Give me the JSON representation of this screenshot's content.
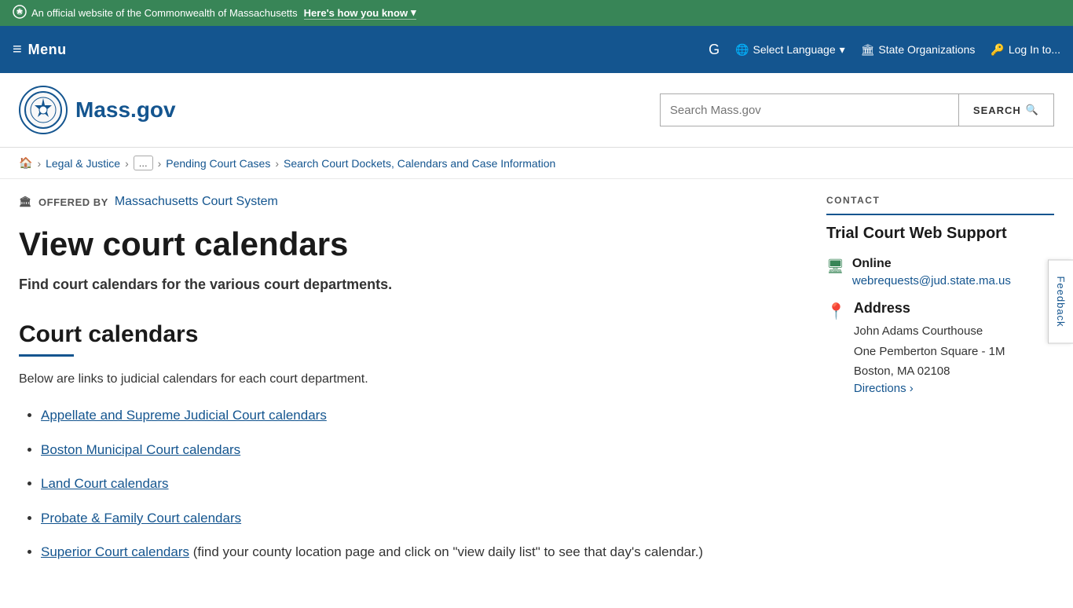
{
  "topBanner": {
    "officialText": "An official website of the Commonwealth of Massachusetts",
    "knowLinkText": "Here's how you know",
    "chevron": "▾"
  },
  "navBar": {
    "menuLabel": "Menu",
    "selectLanguage": "Select Language",
    "stateOrganizations": "State Organizations",
    "logIn": "Log In to..."
  },
  "header": {
    "logoAlt": "Mass.gov",
    "logoText": "Mass.gov",
    "searchPlaceholder": "Search Mass.gov",
    "searchButton": "SEARCH"
  },
  "breadcrumb": {
    "home": "🏠",
    "sep1": "›",
    "link1": "Legal & Justice",
    "sep2": "›",
    "ellipsis": "...",
    "sep3": "›",
    "link2": "Pending Court Cases",
    "sep4": "›",
    "currentPage": "Search Court Dockets, Calendars and Case Information"
  },
  "offeredBy": {
    "label": "OFFERED BY",
    "organization": "Massachusetts Court System"
  },
  "page": {
    "title": "View court calendars",
    "subtitle": "Find court calendars for the various court departments."
  },
  "section": {
    "title": "Court calendars",
    "description": "Below are links to judicial calendars for each court department."
  },
  "links": [
    {
      "text": "Appellate and Supreme Judicial Court calendars",
      "href": "#"
    },
    {
      "text": "Boston Municipal Court calendars",
      "href": "#"
    },
    {
      "text": "Land Court calendars",
      "href": "#"
    },
    {
      "text": "Probate & Family Court calendars",
      "href": "#"
    },
    {
      "linkText": "Superior Court calendars",
      "href": "#",
      "trailing": " (find your county location page and click on \"view daily list\" to see that day's calendar.)"
    }
  ],
  "contact": {
    "sectionLabel": "CONTACT",
    "title": "Trial Court Web Support",
    "onlineLabel": "Online",
    "onlineIcon": "🖥",
    "email": "webrequests@jud.state.ma.us",
    "addressLabel": "Address",
    "addressIcon": "📍",
    "addressLine1": "John Adams Courthouse",
    "addressLine2": "One Pemberton Square - 1M",
    "addressLine3": "Boston, MA 02108",
    "directionsText": "Directions ›"
  },
  "feedback": {
    "label": "Feedback"
  }
}
